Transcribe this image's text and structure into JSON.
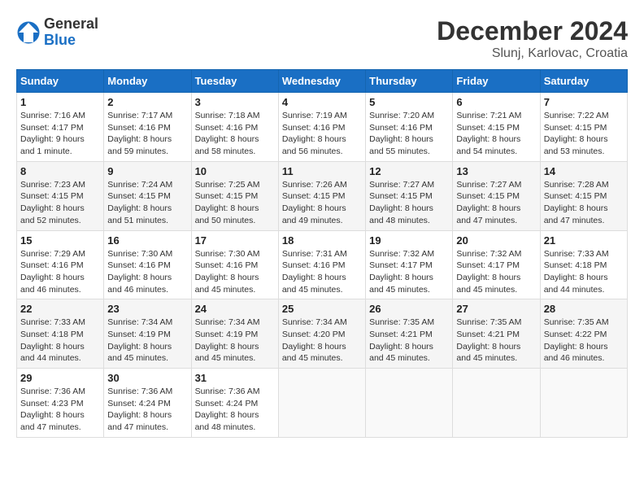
{
  "logo": {
    "general": "General",
    "blue": "Blue"
  },
  "header": {
    "month": "December 2024",
    "location": "Slunj, Karlovac, Croatia"
  },
  "days_of_week": [
    "Sunday",
    "Monday",
    "Tuesday",
    "Wednesday",
    "Thursday",
    "Friday",
    "Saturday"
  ],
  "weeks": [
    [
      {
        "day": "1",
        "sunrise": "7:16 AM",
        "sunset": "4:17 PM",
        "daylight": "9 hours and 1 minute."
      },
      {
        "day": "2",
        "sunrise": "7:17 AM",
        "sunset": "4:16 PM",
        "daylight": "8 hours and 59 minutes."
      },
      {
        "day": "3",
        "sunrise": "7:18 AM",
        "sunset": "4:16 PM",
        "daylight": "8 hours and 58 minutes."
      },
      {
        "day": "4",
        "sunrise": "7:19 AM",
        "sunset": "4:16 PM",
        "daylight": "8 hours and 56 minutes."
      },
      {
        "day": "5",
        "sunrise": "7:20 AM",
        "sunset": "4:16 PM",
        "daylight": "8 hours and 55 minutes."
      },
      {
        "day": "6",
        "sunrise": "7:21 AM",
        "sunset": "4:15 PM",
        "daylight": "8 hours and 54 minutes."
      },
      {
        "day": "7",
        "sunrise": "7:22 AM",
        "sunset": "4:15 PM",
        "daylight": "8 hours and 53 minutes."
      }
    ],
    [
      {
        "day": "8",
        "sunrise": "7:23 AM",
        "sunset": "4:15 PM",
        "daylight": "8 hours and 52 minutes."
      },
      {
        "day": "9",
        "sunrise": "7:24 AM",
        "sunset": "4:15 PM",
        "daylight": "8 hours and 51 minutes."
      },
      {
        "day": "10",
        "sunrise": "7:25 AM",
        "sunset": "4:15 PM",
        "daylight": "8 hours and 50 minutes."
      },
      {
        "day": "11",
        "sunrise": "7:26 AM",
        "sunset": "4:15 PM",
        "daylight": "8 hours and 49 minutes."
      },
      {
        "day": "12",
        "sunrise": "7:27 AM",
        "sunset": "4:15 PM",
        "daylight": "8 hours and 48 minutes."
      },
      {
        "day": "13",
        "sunrise": "7:27 AM",
        "sunset": "4:15 PM",
        "daylight": "8 hours and 47 minutes."
      },
      {
        "day": "14",
        "sunrise": "7:28 AM",
        "sunset": "4:15 PM",
        "daylight": "8 hours and 47 minutes."
      }
    ],
    [
      {
        "day": "15",
        "sunrise": "7:29 AM",
        "sunset": "4:16 PM",
        "daylight": "8 hours and 46 minutes."
      },
      {
        "day": "16",
        "sunrise": "7:30 AM",
        "sunset": "4:16 PM",
        "daylight": "8 hours and 46 minutes."
      },
      {
        "day": "17",
        "sunrise": "7:30 AM",
        "sunset": "4:16 PM",
        "daylight": "8 hours and 45 minutes."
      },
      {
        "day": "18",
        "sunrise": "7:31 AM",
        "sunset": "4:16 PM",
        "daylight": "8 hours and 45 minutes."
      },
      {
        "day": "19",
        "sunrise": "7:32 AM",
        "sunset": "4:17 PM",
        "daylight": "8 hours and 45 minutes."
      },
      {
        "day": "20",
        "sunrise": "7:32 AM",
        "sunset": "4:17 PM",
        "daylight": "8 hours and 45 minutes."
      },
      {
        "day": "21",
        "sunrise": "7:33 AM",
        "sunset": "4:18 PM",
        "daylight": "8 hours and 44 minutes."
      }
    ],
    [
      {
        "day": "22",
        "sunrise": "7:33 AM",
        "sunset": "4:18 PM",
        "daylight": "8 hours and 44 minutes."
      },
      {
        "day": "23",
        "sunrise": "7:34 AM",
        "sunset": "4:19 PM",
        "daylight": "8 hours and 45 minutes."
      },
      {
        "day": "24",
        "sunrise": "7:34 AM",
        "sunset": "4:19 PM",
        "daylight": "8 hours and 45 minutes."
      },
      {
        "day": "25",
        "sunrise": "7:34 AM",
        "sunset": "4:20 PM",
        "daylight": "8 hours and 45 minutes."
      },
      {
        "day": "26",
        "sunrise": "7:35 AM",
        "sunset": "4:21 PM",
        "daylight": "8 hours and 45 minutes."
      },
      {
        "day": "27",
        "sunrise": "7:35 AM",
        "sunset": "4:21 PM",
        "daylight": "8 hours and 45 minutes."
      },
      {
        "day": "28",
        "sunrise": "7:35 AM",
        "sunset": "4:22 PM",
        "daylight": "8 hours and 46 minutes."
      }
    ],
    [
      {
        "day": "29",
        "sunrise": "7:36 AM",
        "sunset": "4:23 PM",
        "daylight": "8 hours and 47 minutes."
      },
      {
        "day": "30",
        "sunrise": "7:36 AM",
        "sunset": "4:24 PM",
        "daylight": "8 hours and 47 minutes."
      },
      {
        "day": "31",
        "sunrise": "7:36 AM",
        "sunset": "4:24 PM",
        "daylight": "8 hours and 48 minutes."
      },
      null,
      null,
      null,
      null
    ]
  ],
  "labels": {
    "sunrise": "Sunrise:",
    "sunset": "Sunset:",
    "daylight": "Daylight:"
  }
}
